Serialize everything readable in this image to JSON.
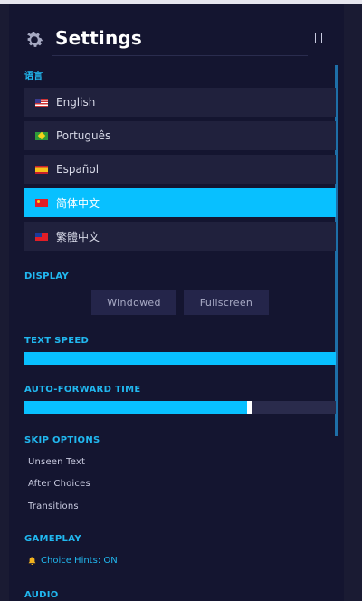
{
  "header": {
    "title": "Settings"
  },
  "language": {
    "label": "语言",
    "items": [
      {
        "label": "English",
        "flag": "us-flag-icon",
        "selected": false
      },
      {
        "label": "Português",
        "flag": "br-flag-icon",
        "selected": false
      },
      {
        "label": "Español",
        "flag": "es-flag-icon",
        "selected": false
      },
      {
        "label": "简体中文",
        "flag": "cn-flag-icon",
        "selected": true
      },
      {
        "label": "繁體中文",
        "flag": "tw-flag-icon",
        "selected": false
      }
    ]
  },
  "display": {
    "label": "DISPLAY",
    "windowed_label": "Windowed",
    "fullscreen_label": "Fullscreen"
  },
  "text_speed": {
    "label": "TEXT SPEED",
    "value_fraction": 1.0
  },
  "auto_forward": {
    "label": "AUTO-FORWARD TIME",
    "value_fraction": 0.72
  },
  "skip": {
    "label": "SKIP OPTIONS",
    "options": [
      "Unseen Text",
      "After Choices",
      "Transitions"
    ]
  },
  "gameplay": {
    "label": "GAMEPLAY",
    "hint_label": "Choice Hints: ON"
  },
  "audio": {
    "label": "AUDIO"
  },
  "colors": {
    "accent": "#08c0ff",
    "label_blue": "#21b8f0",
    "panel": "#141530",
    "row": "#20213d"
  }
}
